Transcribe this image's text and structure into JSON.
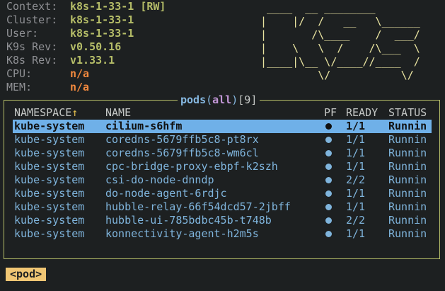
{
  "header": {
    "context": {
      "label": "Context:",
      "value": "k8s-1-33-1 [RW]"
    },
    "cluster": {
      "label": "Cluster:",
      "value": "k8s-1-33-1"
    },
    "user": {
      "label": "User:",
      "value": "k8s-1-33-1"
    },
    "k9s_rev": {
      "label": "K9s Rev:",
      "value": "v0.50.16"
    },
    "k8s_rev": {
      "label": "K8s Rev:",
      "value": "v1.33.1"
    },
    "cpu": {
      "label": "CPU:",
      "value": "n/a"
    },
    "mem": {
      "label": "MEM:",
      "value": "n/a"
    }
  },
  "logo": " ____  __ ________\n|    |/  /   __   \\______\n|       /\\____    /  ___/\n|    \\   \\  /    /\\___  \\\n|____|\\__ \\/____//____  /\n         \\/           \\/",
  "pane": {
    "resource": "pods",
    "open_paren": "(",
    "scope": "all",
    "close_paren": ")",
    "count": "[9]"
  },
  "table": {
    "columns": [
      "NAMESPACE",
      "NAME",
      "PF",
      "READY",
      "STATUS"
    ],
    "sort_indicator": "↑",
    "rows": [
      {
        "namespace": "kube-system",
        "name": "cilium-s6hfm",
        "ready": "1/1",
        "status": "Runnin"
      },
      {
        "namespace": "kube-system",
        "name": "coredns-5679ffb5c8-pt8rx",
        "ready": "1/1",
        "status": "Runnin"
      },
      {
        "namespace": "kube-system",
        "name": "coredns-5679ffb5c8-wm6cl",
        "ready": "1/1",
        "status": "Runnin"
      },
      {
        "namespace": "kube-system",
        "name": "cpc-bridge-proxy-ebpf-k2szh",
        "ready": "1/1",
        "status": "Runnin"
      },
      {
        "namespace": "kube-system",
        "name": "csi-do-node-dnndp",
        "ready": "2/2",
        "status": "Runnin"
      },
      {
        "namespace": "kube-system",
        "name": "do-node-agent-6rdjc",
        "ready": "1/1",
        "status": "Runnin"
      },
      {
        "namespace": "kube-system",
        "name": "hubble-relay-66f54dcd57-2jbff",
        "ready": "1/1",
        "status": "Runnin"
      },
      {
        "namespace": "kube-system",
        "name": "hubble-ui-785bdbc45b-t748b",
        "ready": "2/2",
        "status": "Runnin"
      },
      {
        "namespace": "kube-system",
        "name": "konnectivity-agent-h2m5s",
        "ready": "1/1",
        "status": "Runnin"
      }
    ]
  },
  "breadcrumb": "<pod>"
}
